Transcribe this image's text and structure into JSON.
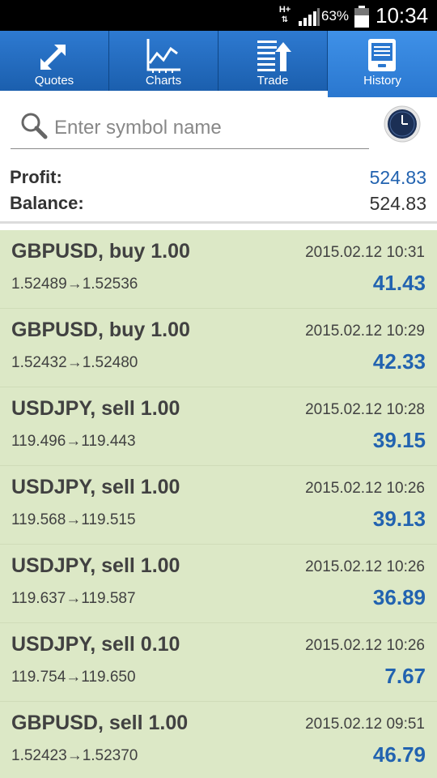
{
  "status_bar": {
    "network": "H+",
    "battery_percent": "63%",
    "time": "10:34",
    "icons": [
      "network-type-icon",
      "signal-icon",
      "battery-icon"
    ]
  },
  "tabs": [
    {
      "label": "Quotes",
      "icon": "quotes-arrows-icon",
      "active": false
    },
    {
      "label": "Charts",
      "icon": "chart-line-icon",
      "active": false
    },
    {
      "label": "Trade",
      "icon": "trade-list-icon",
      "active": false
    },
    {
      "label": "History",
      "icon": "history-book-icon",
      "active": true
    }
  ],
  "search": {
    "placeholder": "Enter symbol name",
    "value": "",
    "icon": "search-icon",
    "period_button_icon": "clock-icon"
  },
  "summary": {
    "profit_label": "Profit:",
    "profit_value": "524.83",
    "balance_label": "Balance:",
    "balance_value": "524.83"
  },
  "deals": [
    {
      "symbol": "GBPUSD, buy 1.00",
      "time": "2015.02.12 10:31",
      "open_price": "1.52489",
      "close_price": "1.52536",
      "profit": "41.43"
    },
    {
      "symbol": "GBPUSD, buy 1.00",
      "time": "2015.02.12 10:29",
      "open_price": "1.52432",
      "close_price": "1.52480",
      "profit": "42.33"
    },
    {
      "symbol": "USDJPY, sell 1.00",
      "time": "2015.02.12 10:28",
      "open_price": "119.496",
      "close_price": "119.443",
      "profit": "39.15"
    },
    {
      "symbol": "USDJPY, sell 1.00",
      "time": "2015.02.12 10:26",
      "open_price": "119.568",
      "close_price": "119.515",
      "profit": "39.13"
    },
    {
      "symbol": "USDJPY, sell 1.00",
      "time": "2015.02.12 10:26",
      "open_price": "119.637",
      "close_price": "119.587",
      "profit": "36.89"
    },
    {
      "symbol": "USDJPY, sell 0.10",
      "time": "2015.02.12 10:26",
      "open_price": "119.754",
      "close_price": "119.650",
      "profit": "7.67"
    },
    {
      "symbol": "GBPUSD, sell 1.00",
      "time": "2015.02.12 09:51",
      "open_price": "1.52423",
      "close_price": "1.52370",
      "profit": "46.79"
    }
  ],
  "price_arrow": "→",
  "colors": {
    "tab_bar": "#2e7ad1",
    "tab_active": "#3f91e8",
    "profit_blue": "#2263b0",
    "deal_background": "#dce8c6",
    "text_dark": "#414141"
  }
}
